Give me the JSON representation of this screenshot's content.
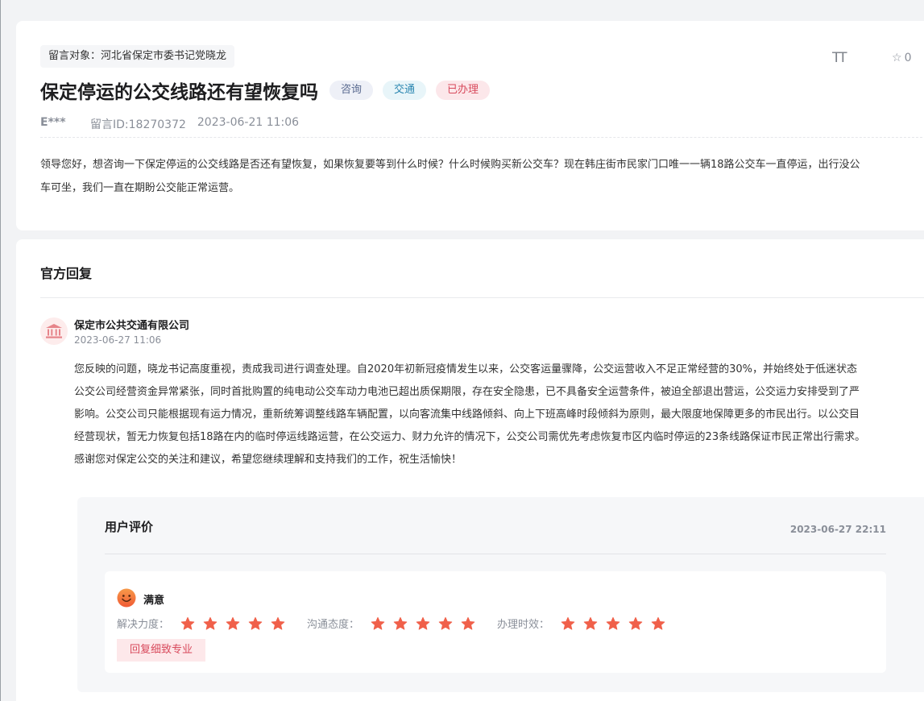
{
  "message": {
    "target": "留言对象：河北省保定市委书记党晓龙",
    "font_size_icon": "TT",
    "favorite_count": "0",
    "title": "保定停运的公交线路还有望恢复吗",
    "tags": [
      "咨询",
      "交通",
      "已办理"
    ],
    "author": "E***",
    "message_id": "留言ID:18270372",
    "datetime": "2023-06-21 11:06",
    "body_lines": [
      "领导您好，想咨询一下保定停运的公交线路是否还有望恢复，如果恢复要等到什么时候？什么时候购买新公交车？现在韩庄街市民家门口唯一一辆18路公交车一直停运，出行没公",
      "车可坐，我们一直在期盼公交能正常运营。"
    ]
  },
  "reply": {
    "heading": "官方回复",
    "org_name": "保定市公共交通有限公司",
    "org_time": "2023-06-27 11:06",
    "body_lines": [
      "您反映的问题，晓龙书记高度重视，责成我司进行调查处理。自2020年初新冠疫情发生以来，公交客运量骤降，公交运营收入不足正常经营的30%，并始终处于低迷状态",
      "公交公司经营资金异常紧张，同时首批购置的纯电动公交车动力电池已超出质保期限，存在安全隐患，已不具备安全运营条件，被迫全部退出营运，公交运力安排受到了严",
      "影响。公交公司只能根据现有运力情况，重新统筹调整线路车辆配置，以向客流集中线路倾斜、向上下班高峰时段倾斜为原则，最大限度地保障更多的市民出行。以公交目",
      "经营现状，暂无力恢复包括18路在内的临时停运线路运营，在公交运力、财力允许的情况下，公交公司需优先考虑恢复市区内临时停运的23条线路保证市民正常出行需求。",
      "感谢您对保定公交的关注和建议，希望您继续理解和支持我们的工作，祝生活愉快！"
    ]
  },
  "evaluation": {
    "heading": "用户评价",
    "datetime": "2023-06-27 22:11",
    "satisfaction": "满意",
    "ratings": [
      {
        "label": "解决力度：",
        "stars": 5
      },
      {
        "label": "沟通态度：",
        "stars": 5
      },
      {
        "label": "办理时效：",
        "stars": 5
      }
    ],
    "feedback_tag": "回复细致专业"
  },
  "colors": {
    "accent_red": "#d84a5c",
    "star_color": "#f0604a",
    "smile_color": "#f3763c"
  }
}
